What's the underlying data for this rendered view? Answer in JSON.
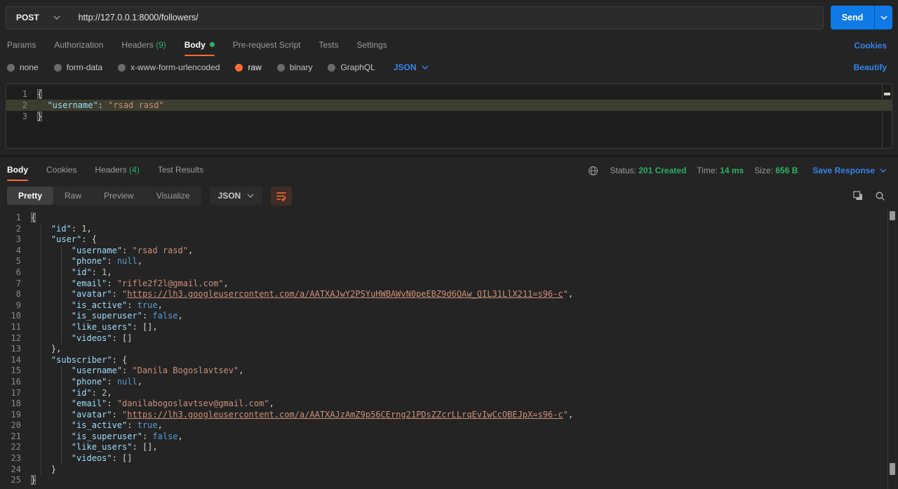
{
  "colors": {
    "accent_orange": "#ff6c37",
    "link_blue": "#3584f0",
    "send_blue": "#0f7ae5",
    "success_green": "#2bb263",
    "json_key": "#9cdcfe",
    "json_string": "#ce9178",
    "json_number": "#b5cea8",
    "json_keyword": "#569cd6"
  },
  "request": {
    "method": "POST",
    "url": "http://127.0.0.1:8000/followers/",
    "send_label": "Send",
    "cookies_link": "Cookies",
    "beautify_link": "Beautify",
    "raw_language": "JSON",
    "tabs": [
      {
        "label": "Params"
      },
      {
        "label": "Authorization"
      },
      {
        "label": "Headers",
        "badge": "(9)"
      },
      {
        "label": "Body",
        "active": true,
        "dot": true
      },
      {
        "label": "Pre-request Script"
      },
      {
        "label": "Tests"
      },
      {
        "label": "Settings"
      }
    ],
    "body_modes": [
      {
        "label": "none"
      },
      {
        "label": "form-data"
      },
      {
        "label": "x-www-form-urlencoded"
      },
      {
        "label": "raw",
        "selected": true
      },
      {
        "label": "binary"
      },
      {
        "label": "GraphQL"
      }
    ],
    "editor_lines": [
      {
        "n": 1,
        "tokens": [
          {
            "c": "mb",
            "t": "{"
          }
        ]
      },
      {
        "n": 2,
        "hl": true,
        "tokens": [
          {
            "c": "pn",
            "t": "  "
          },
          {
            "c": "key",
            "t": "\"username\""
          },
          {
            "c": "pn",
            "t": ": "
          },
          {
            "c": "str",
            "t": "\"rsad rasd\""
          }
        ]
      },
      {
        "n": 3,
        "tokens": [
          {
            "c": "mb",
            "t": "}"
          }
        ]
      }
    ]
  },
  "response": {
    "tabs": [
      {
        "label": "Body",
        "active": true
      },
      {
        "label": "Cookies"
      },
      {
        "label": "Headers",
        "badge": "(4)"
      },
      {
        "label": "Test Results"
      }
    ],
    "status_label": "Status:",
    "status_value": "201 Created",
    "time_label": "Time:",
    "time_value": "14 ms",
    "size_label": "Size:",
    "size_value": "656 B",
    "save_label": "Save Response",
    "format": "JSON",
    "view_tabs": [
      {
        "label": "Pretty",
        "active": true
      },
      {
        "label": "Raw"
      },
      {
        "label": "Preview"
      },
      {
        "label": "Visualize"
      }
    ],
    "body_lines": [
      {
        "n": 1,
        "tokens": [
          {
            "c": "mb",
            "t": "{"
          }
        ]
      },
      {
        "n": 2,
        "g": [
          0
        ],
        "tokens": [
          {
            "c": "pn",
            "t": "    "
          },
          {
            "c": "key",
            "t": "\"id\""
          },
          {
            "c": "pn",
            "t": ": "
          },
          {
            "c": "num",
            "t": "1"
          },
          {
            "c": "pn",
            "t": ","
          }
        ]
      },
      {
        "n": 3,
        "g": [
          0
        ],
        "tokens": [
          {
            "c": "pn",
            "t": "    "
          },
          {
            "c": "key",
            "t": "\"user\""
          },
          {
            "c": "pn",
            "t": ": {"
          }
        ]
      },
      {
        "n": 4,
        "g": [
          0,
          4
        ],
        "tokens": [
          {
            "c": "pn",
            "t": "        "
          },
          {
            "c": "key",
            "t": "\"username\""
          },
          {
            "c": "pn",
            "t": ": "
          },
          {
            "c": "str",
            "t": "\"rsad rasd\""
          },
          {
            "c": "pn",
            "t": ","
          }
        ]
      },
      {
        "n": 5,
        "g": [
          0,
          4
        ],
        "tokens": [
          {
            "c": "pn",
            "t": "        "
          },
          {
            "c": "key",
            "t": "\"phone\""
          },
          {
            "c": "pn",
            "t": ": "
          },
          {
            "c": "kw",
            "t": "null"
          },
          {
            "c": "pn",
            "t": ","
          }
        ]
      },
      {
        "n": 6,
        "g": [
          0,
          4
        ],
        "tokens": [
          {
            "c": "pn",
            "t": "        "
          },
          {
            "c": "key",
            "t": "\"id\""
          },
          {
            "c": "pn",
            "t": ": "
          },
          {
            "c": "num",
            "t": "1"
          },
          {
            "c": "pn",
            "t": ","
          }
        ]
      },
      {
        "n": 7,
        "g": [
          0,
          4
        ],
        "tokens": [
          {
            "c": "pn",
            "t": "        "
          },
          {
            "c": "key",
            "t": "\"email\""
          },
          {
            "c": "pn",
            "t": ": "
          },
          {
            "c": "str",
            "t": "\"rifle2f2l@gmail.com\""
          },
          {
            "c": "pn",
            "t": ","
          }
        ]
      },
      {
        "n": 8,
        "g": [
          0,
          4
        ],
        "tokens": [
          {
            "c": "pn",
            "t": "        "
          },
          {
            "c": "key",
            "t": "\"avatar\""
          },
          {
            "c": "pn",
            "t": ": "
          },
          {
            "c": "str",
            "t": "\""
          },
          {
            "c": "lk",
            "t": "https://lh3.googleusercontent.com/a/AATXAJwY2PSYuHWBAWvN0peEBZ9d6QAw_QIL31LlX211=s96-c"
          },
          {
            "c": "str",
            "t": "\""
          },
          {
            "c": "pn",
            "t": ","
          }
        ]
      },
      {
        "n": 9,
        "g": [
          0,
          4
        ],
        "tokens": [
          {
            "c": "pn",
            "t": "        "
          },
          {
            "c": "key",
            "t": "\"is_active\""
          },
          {
            "c": "pn",
            "t": ": "
          },
          {
            "c": "kw",
            "t": "true"
          },
          {
            "c": "pn",
            "t": ","
          }
        ]
      },
      {
        "n": 10,
        "g": [
          0,
          4
        ],
        "tokens": [
          {
            "c": "pn",
            "t": "        "
          },
          {
            "c": "key",
            "t": "\"is_superuser\""
          },
          {
            "c": "pn",
            "t": ": "
          },
          {
            "c": "kw",
            "t": "false"
          },
          {
            "c": "pn",
            "t": ","
          }
        ]
      },
      {
        "n": 11,
        "g": [
          0,
          4
        ],
        "tokens": [
          {
            "c": "pn",
            "t": "        "
          },
          {
            "c": "key",
            "t": "\"like_users\""
          },
          {
            "c": "pn",
            "t": ": [],"
          }
        ]
      },
      {
        "n": 12,
        "g": [
          0,
          4
        ],
        "tokens": [
          {
            "c": "pn",
            "t": "        "
          },
          {
            "c": "key",
            "t": "\"videos\""
          },
          {
            "c": "pn",
            "t": ": []"
          }
        ]
      },
      {
        "n": 13,
        "g": [
          0
        ],
        "tokens": [
          {
            "c": "pn",
            "t": "    },"
          }
        ]
      },
      {
        "n": 14,
        "g": [
          0
        ],
        "tokens": [
          {
            "c": "pn",
            "t": "    "
          },
          {
            "c": "key",
            "t": "\"subscriber\""
          },
          {
            "c": "pn",
            "t": ": {"
          }
        ]
      },
      {
        "n": 15,
        "g": [
          0,
          4
        ],
        "tokens": [
          {
            "c": "pn",
            "t": "        "
          },
          {
            "c": "key",
            "t": "\"username\""
          },
          {
            "c": "pn",
            "t": ": "
          },
          {
            "c": "str",
            "t": "\"Danila Bogoslavtsev\""
          },
          {
            "c": "pn",
            "t": ","
          }
        ]
      },
      {
        "n": 16,
        "g": [
          0,
          4
        ],
        "tokens": [
          {
            "c": "pn",
            "t": "        "
          },
          {
            "c": "key",
            "t": "\"phone\""
          },
          {
            "c": "pn",
            "t": ": "
          },
          {
            "c": "kw",
            "t": "null"
          },
          {
            "c": "pn",
            "t": ","
          }
        ]
      },
      {
        "n": 17,
        "g": [
          0,
          4
        ],
        "tokens": [
          {
            "c": "pn",
            "t": "        "
          },
          {
            "c": "key",
            "t": "\"id\""
          },
          {
            "c": "pn",
            "t": ": "
          },
          {
            "c": "num",
            "t": "2"
          },
          {
            "c": "pn",
            "t": ","
          }
        ]
      },
      {
        "n": 18,
        "g": [
          0,
          4
        ],
        "tokens": [
          {
            "c": "pn",
            "t": "        "
          },
          {
            "c": "key",
            "t": "\"email\""
          },
          {
            "c": "pn",
            "t": ": "
          },
          {
            "c": "str",
            "t": "\"danilabogoslavtsev@gmail.com\""
          },
          {
            "c": "pn",
            "t": ","
          }
        ]
      },
      {
        "n": 19,
        "g": [
          0,
          4
        ],
        "tokens": [
          {
            "c": "pn",
            "t": "        "
          },
          {
            "c": "key",
            "t": "\"avatar\""
          },
          {
            "c": "pn",
            "t": ": "
          },
          {
            "c": "str",
            "t": "\""
          },
          {
            "c": "lk",
            "t": "https://lh3.googleusercontent.com/a/AATXAJzAmZ9p56CErng21PDsZZcrLLrqEvIwCcOBEJpX=s96-c"
          },
          {
            "c": "str",
            "t": "\""
          },
          {
            "c": "pn",
            "t": ","
          }
        ]
      },
      {
        "n": 20,
        "g": [
          0,
          4
        ],
        "tokens": [
          {
            "c": "pn",
            "t": "        "
          },
          {
            "c": "key",
            "t": "\"is_active\""
          },
          {
            "c": "pn",
            "t": ": "
          },
          {
            "c": "kw",
            "t": "true"
          },
          {
            "c": "pn",
            "t": ","
          }
        ]
      },
      {
        "n": 21,
        "g": [
          0,
          4
        ],
        "tokens": [
          {
            "c": "pn",
            "t": "        "
          },
          {
            "c": "key",
            "t": "\"is_superuser\""
          },
          {
            "c": "pn",
            "t": ": "
          },
          {
            "c": "kw",
            "t": "false"
          },
          {
            "c": "pn",
            "t": ","
          }
        ]
      },
      {
        "n": 22,
        "g": [
          0,
          4
        ],
        "tokens": [
          {
            "c": "pn",
            "t": "        "
          },
          {
            "c": "key",
            "t": "\"like_users\""
          },
          {
            "c": "pn",
            "t": ": [],"
          }
        ]
      },
      {
        "n": 23,
        "g": [
          0,
          4
        ],
        "tokens": [
          {
            "c": "pn",
            "t": "        "
          },
          {
            "c": "key",
            "t": "\"videos\""
          },
          {
            "c": "pn",
            "t": ": []"
          }
        ]
      },
      {
        "n": 24,
        "g": [
          0
        ],
        "tokens": [
          {
            "c": "pn",
            "t": "    }"
          }
        ]
      },
      {
        "n": 25,
        "tokens": [
          {
            "c": "mb",
            "t": "}"
          }
        ]
      }
    ]
  }
}
